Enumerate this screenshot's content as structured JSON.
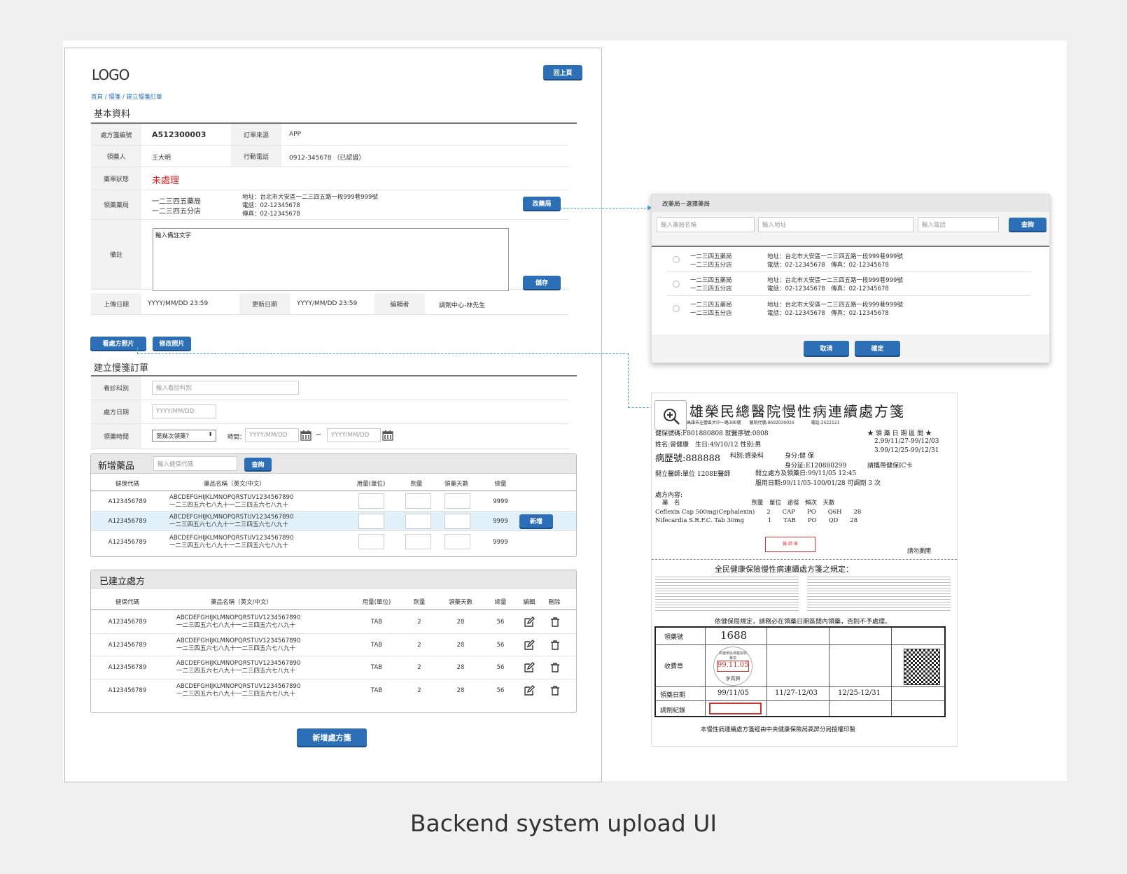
{
  "header": {
    "logo": "LOGO",
    "back_button": "回上頁",
    "breadcrumb": "首頁 / 慢箋 / 建立慢箋訂單"
  },
  "basic": {
    "title": "基本資料",
    "rx_no_label": "處方箋編號",
    "rx_no": "A512300003",
    "source_label": "訂單來源",
    "source": "APP",
    "receiver_label": "領藥人",
    "receiver": "王大明",
    "phone_label": "行動電話",
    "phone": "0912-345678 （已認證）",
    "status_label": "藥單狀態",
    "status": "未處理",
    "pharmacy_label": "領藥藥局",
    "pharmacy_name1": "一二三四五藥局",
    "pharmacy_name2": "一二三四五分店",
    "pharmacy_addr": "地址：台北市大安區一二三四五路一段999巷999號",
    "pharmacy_tel": "電話：02-12345678",
    "pharmacy_fax": "傳真：02-12345678",
    "change_pharmacy": "改藥局",
    "note_label": "備註",
    "note_placeholder": "輸入備註文字",
    "save": "儲存",
    "upload_label": "上傳日期",
    "upload": "YYYY/MM/DD 23:59",
    "update_label": "更新日期",
    "update": "YYYY/MM/DD 23:59",
    "editor_label": "編輯者",
    "editor": "調劑中心-林先生",
    "view_photo": "看處方照片",
    "edit_photo": "修改照片"
  },
  "order": {
    "title": "建立慢箋訂單",
    "dept_label": "看診科別",
    "dept_placeholder": "輸入看診科別",
    "date_label": "處方日期",
    "date_placeholder": "YYYY/MM/DD",
    "time_label": "領藥時間",
    "times_select": "第幾次領藥？",
    "period_label": "時間：",
    "from_placeholder": "YYYY/MM/DD",
    "tilde": "~",
    "to_placeholder": "YYYY/MM/DD"
  },
  "add_drug": {
    "title": "新增藥品",
    "search_placeholder": "輸入健保代碼",
    "search_button": "查詢",
    "columns": [
      "健保代碼",
      "藥品名稱（英文/中文）",
      "用量(單位)",
      "劑量",
      "領藥天數",
      "總量"
    ],
    "rows": [
      {
        "code": "A123456789",
        "en": "ABCDEFGHIJKLMNOPQRSTUV1234567890",
        "zh": "一二三四五六七八九十一二三四五六七八九十",
        "total": "9999"
      },
      {
        "code": "A123456789",
        "en": "ABCDEFGHIJKLMNOPQRSTUV1234567890",
        "zh": "一二三四五六七八九十一二三四五六七八九十",
        "total": "9999"
      },
      {
        "code": "A123456789",
        "en": "ABCDEFGHIJKLMNOPQRSTUV1234567890",
        "zh": "一二三四五六七八九十一二三四五六七八九十",
        "total": "9999"
      }
    ],
    "add_button": "新增"
  },
  "created": {
    "title": "已建立處方",
    "columns": [
      "健保代碼",
      "藥品名稱（英文/中文）",
      "用量(單位)",
      "劑量",
      "領藥天數",
      "總量",
      "編輯",
      "刪除"
    ],
    "rows": [
      {
        "code": "A123456789",
        "en": "ABCDEFGHIJKLMNOPQRSTUV1234567890",
        "zh": "一二三四五六七八九十一二三四五六七八九十",
        "unit": "TAB",
        "dose": "2",
        "days": "28",
        "total": "56"
      },
      {
        "code": "A123456789",
        "en": "ABCDEFGHIJKLMNOPQRSTUV1234567890",
        "zh": "一二三四五六七八九十一二三四五六七八九十",
        "unit": "TAB",
        "dose": "2",
        "days": "28",
        "total": "56"
      },
      {
        "code": "A123456789",
        "en": "ABCDEFGHIJKLMNOPQRSTUV1234567890",
        "zh": "一二三四五六七八九十一二三四五六七八九十",
        "unit": "TAB",
        "dose": "2",
        "days": "28",
        "total": "56"
      },
      {
        "code": "A123456789",
        "en": "ABCDEFGHIJKLMNOPQRSTUV1234567890",
        "zh": "一二三四五六七八九十一二三四五六七八九十",
        "unit": "TAB",
        "dose": "2",
        "days": "28",
        "total": "56"
      }
    ],
    "new_rx_button": "新增處方箋"
  },
  "modal": {
    "title": "改藥局－選擇藥局",
    "name_placeholder": "輸入藥局名稱",
    "addr_placeholder": "輸入地址",
    "tel_placeholder": "輸入電話",
    "search": "查詢",
    "items": [
      {
        "name1": "一二三四五藥局",
        "name2": "一二三四五分店",
        "addr": "地址：台北市大安區一二三四五路一段999巷999號",
        "contact": "電話：02-12345678　傳真：02-12345678"
      },
      {
        "name1": "一二三四五藥局",
        "name2": "一二三四五分店",
        "addr": "地址：台北市大安區一二三四五路一段999巷999號",
        "contact": "電話：02-12345678　傳真：02-12345678"
      },
      {
        "name1": "一二三四五藥局",
        "name2": "一二三四五分店",
        "addr": "地址：台北市大安區一二三四五路一段999巷999號",
        "contact": "電話：02-12345678　傳真：02-12345678"
      }
    ],
    "cancel": "取消",
    "confirm": "確定"
  },
  "prescription_image": {
    "title": "雄榮民總醫院慢性病連續處方箋",
    "hospital_line": "高雄市左營區大中一路386號　　醫院代號:0602030026　　　　電話:3422121",
    "insurance_line": "健保號碼:F801880808 就醫序號:0808",
    "period_header": "★ 領 藥 日 期 區 間 ★",
    "patient_line": "姓名:曾健康　生日:49/10/12 性別:男",
    "history_no": "病歷號:888888",
    "dept": "科別:感染科",
    "identity": "身分:健 保",
    "period1": "2.99/11/27-99/12/03",
    "period2": "3.99/12/25-99/12/31",
    "id_line": "身分証:E120880299",
    "card_note": "請攜帶健保IC卡",
    "doctor_line": "開立醫師:單位 1208E醫師",
    "issue_line": "開立處方及領藥日:99/11/05 12:45",
    "usage_line": "服用日期:99/11/05-100/01/28 可調劑 3 次",
    "content_label": "處方內容:",
    "drug_header": "藥　名　　　　　　　　　　　　劑量　單位　途徑　頻次　天數",
    "drug1": "Ceflexin Cap 500mg(Cephalexin)　　2　　CAP　　PO　　Q6H　　28",
    "drug2": "Nifecardia S.R.F.C. Tab 30mg　　　　1　　TAB　　PO　　QD　　28",
    "stamp": "醫 師 章",
    "keep_note": "請勿撕開",
    "rules_title": "全民健康保險慢性病連續處方箋之規定：",
    "rules_foot": "依健保局規定，請務必在領藥日期區間內領藥，否則不予處理。",
    "tbl_no_label": "領藥號",
    "tbl_no": "1688",
    "tbl_fee_label": "收費章",
    "tbl_fee_date": "99.11.05",
    "tbl_seal_top": "高雄榮民總醫院收費章",
    "tbl_seal_bot": "李高興",
    "tbl_date_label": "領藥日期",
    "tbl_d1": "99/11/05",
    "tbl_d2": "11/27-12/03",
    "tbl_d3": "12/25-12/31",
    "tbl_record_label": "調劑紀錄",
    "footer": "本慢性病連續處方箋經由中央健康保險局高屏分局授權印製"
  },
  "caption": "Backend system upload UI",
  "colors": {
    "primary": "#2d6fb6",
    "status_red": "#e02020",
    "dashed_link": "#4fa8d8"
  }
}
